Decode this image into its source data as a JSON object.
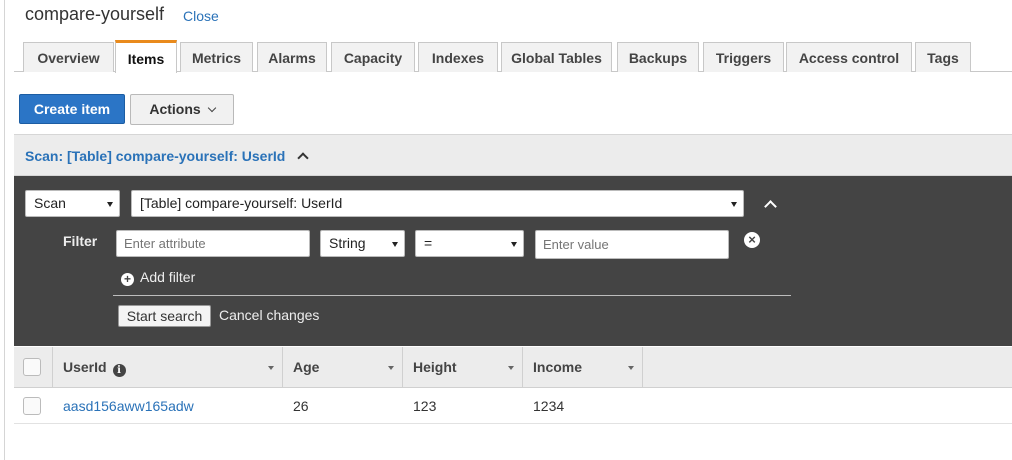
{
  "header": {
    "title": "compare-yourself",
    "close_label": "Close"
  },
  "tabs": [
    {
      "label": "Overview",
      "active": false
    },
    {
      "label": "Items",
      "active": true
    },
    {
      "label": "Metrics",
      "active": false
    },
    {
      "label": "Alarms",
      "active": false
    },
    {
      "label": "Capacity",
      "active": false
    },
    {
      "label": "Indexes",
      "active": false
    },
    {
      "label": "Global Tables",
      "active": false
    },
    {
      "label": "Backups",
      "active": false
    },
    {
      "label": "Triggers",
      "active": false
    },
    {
      "label": "Access control",
      "active": false
    },
    {
      "label": "Tags",
      "active": false
    }
  ],
  "toolbar": {
    "create_label": "Create item",
    "actions_label": "Actions"
  },
  "scan": {
    "header_title": "Scan: [Table] compare-yourself: UserId",
    "mode": "Scan",
    "target": "[Table] compare-yourself: UserId",
    "filter_label": "Filter",
    "attribute_placeholder": "Enter attribute",
    "type": "String",
    "operator": "=",
    "value_placeholder": "Enter value",
    "add_filter_label": "Add filter",
    "start_label": "Start search",
    "cancel_label": "Cancel changes"
  },
  "table": {
    "columns": [
      "UserId",
      "Age",
      "Height",
      "Income"
    ],
    "rows": [
      {
        "UserId": "aasd156aww165adw",
        "Age": "26",
        "Height": "123",
        "Income": "1234"
      }
    ]
  },
  "colors": {
    "accent": "#2b75c6",
    "tab_active": "#e98a1c",
    "panel": "#444444",
    "link": "#2a72b8"
  }
}
